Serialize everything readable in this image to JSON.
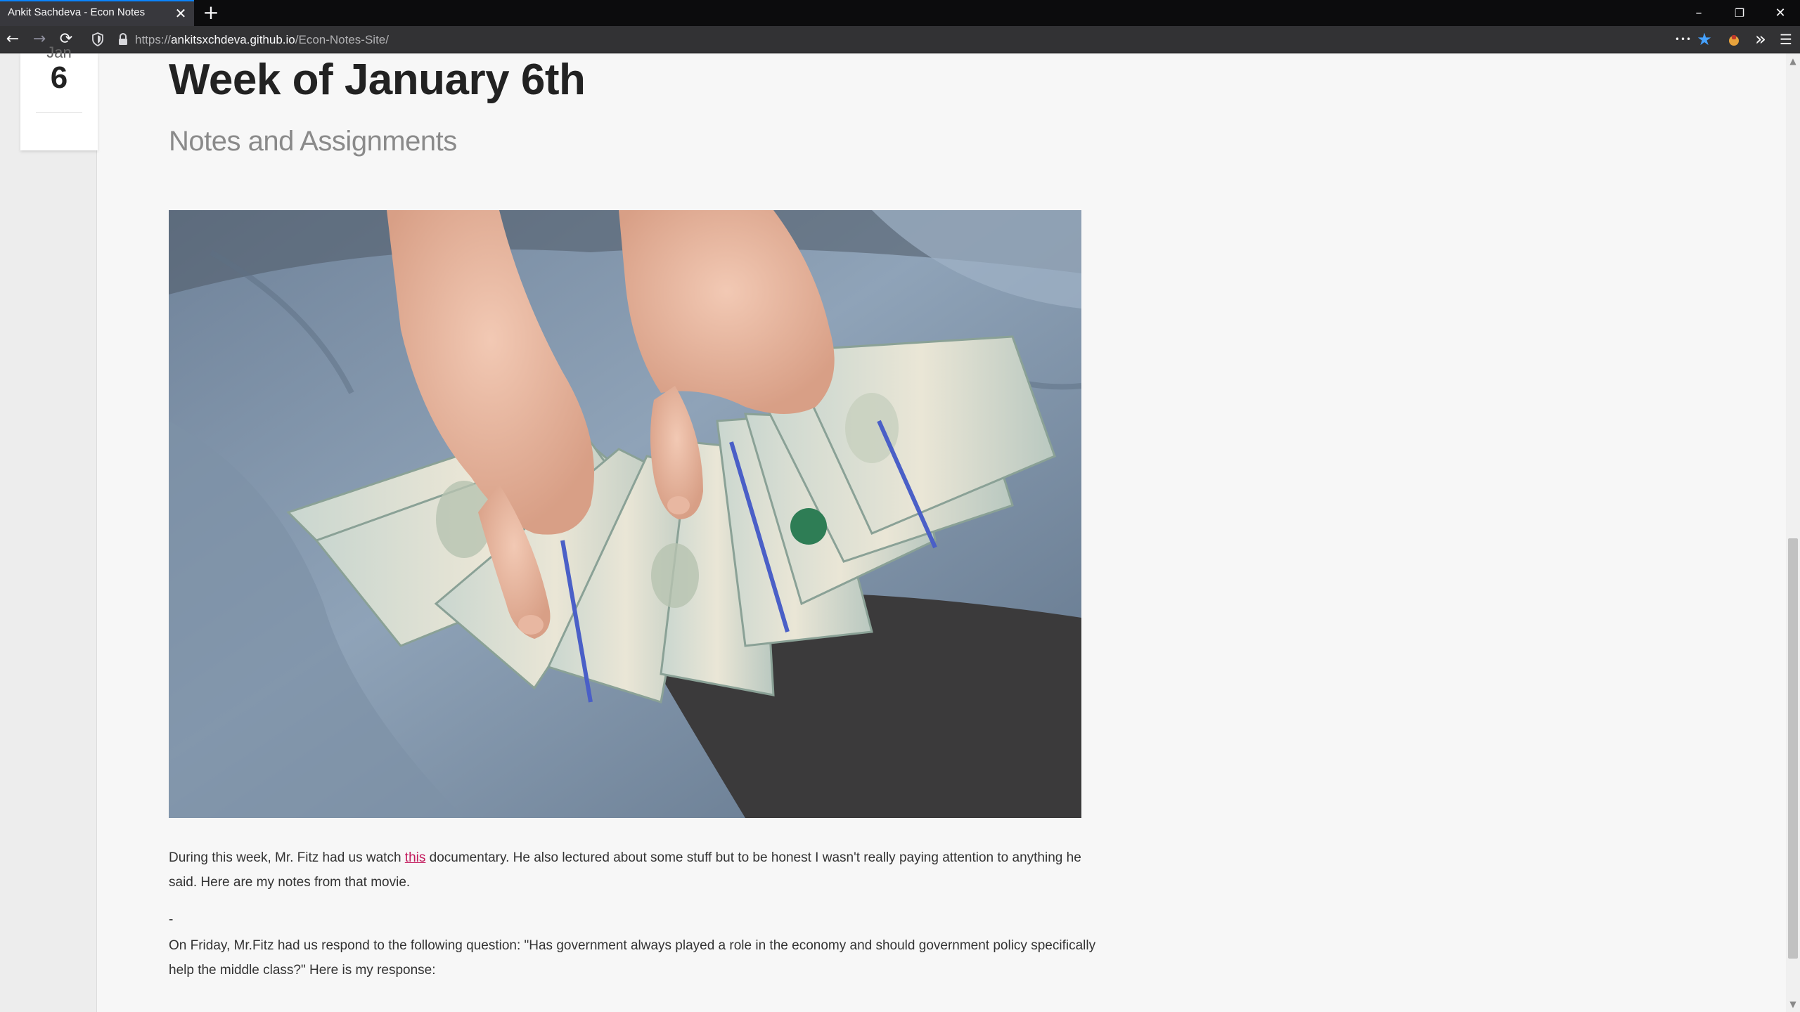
{
  "browser": {
    "tab_title": "Ankit Sachdeva - Econ Notes",
    "tab_close": "✕",
    "new_tab": "+",
    "url_host": "ankitsxchdeva.github.io",
    "url_prefix": "https://",
    "url_path": "/Econ-Notes-Site/",
    "window_controls": {
      "minimize": "–",
      "restore": "❐",
      "close": "✕"
    },
    "nav": {
      "back": "←",
      "forward": "→",
      "reload": "⟳"
    },
    "toolbar": {
      "more": "•••",
      "bookmark": "★",
      "overflow": "»",
      "menu": "☰"
    },
    "accent_color": "#0a84ff"
  },
  "post": {
    "date_month": "Jan",
    "date_day": "6",
    "title": "Week of January 6th",
    "subtitle": "Notes and Assignments",
    "image_alt": "Hands fanning out a stack of hundred dollar bills",
    "paragraph1_before": "During this week, Mr. Fitz had us watch ",
    "paragraph1_link": "this",
    "paragraph1_after": " documentary. He also lectured about some stuff but to be honest I wasn't really paying attention to anything he said. Here are my notes from that movie.",
    "separator": "-",
    "paragraph2": "On Friday, Mr.Fitz had us respond to the following question: \"Has government always played a role in the economy and should government policy specifically help the middle class?\" Here is my response:",
    "link_color": "#c2185b"
  }
}
